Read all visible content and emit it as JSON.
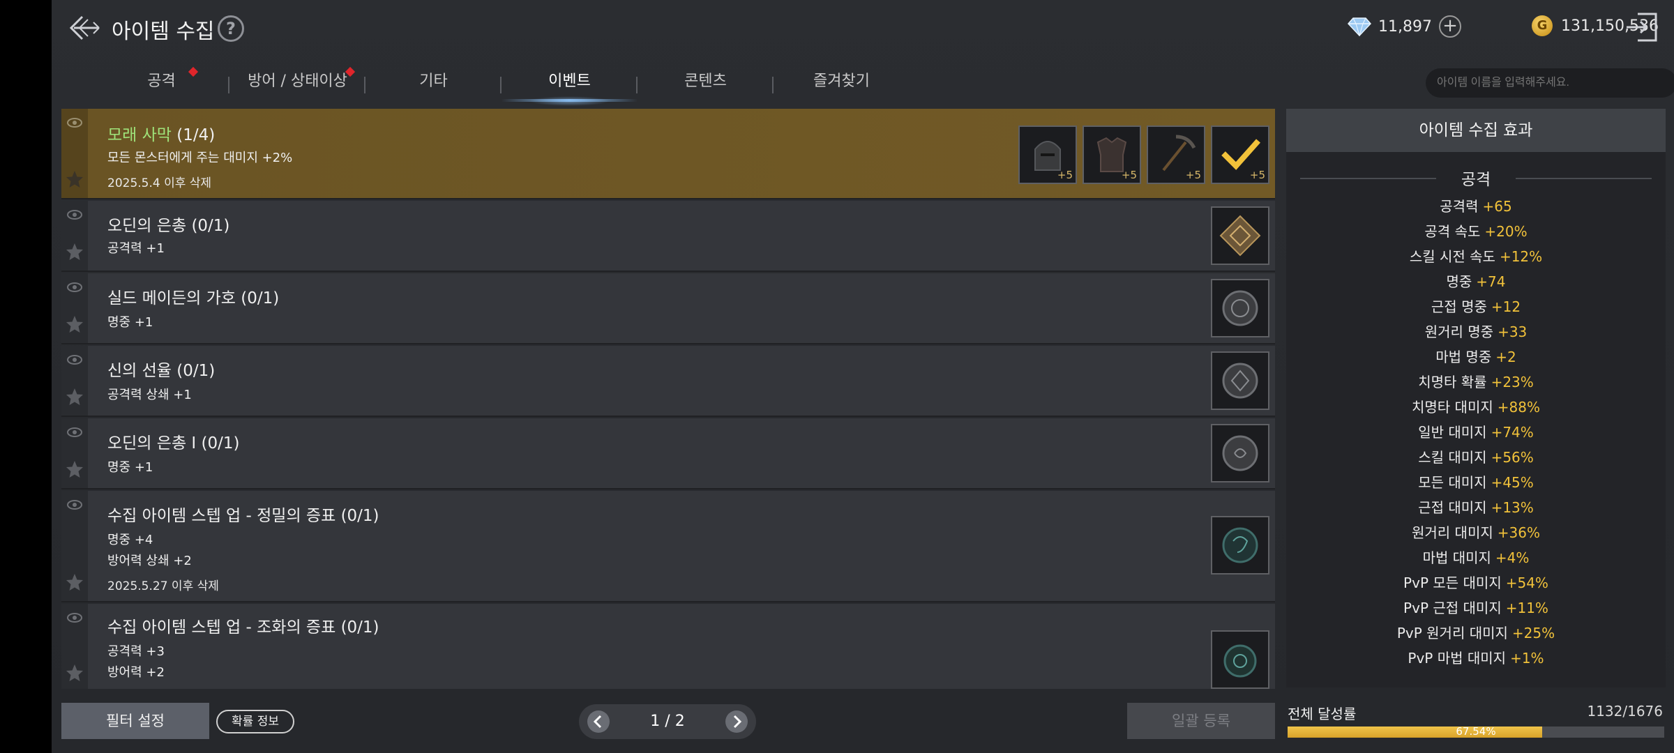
{
  "header": {
    "title": "아이템 수집",
    "help_icon": "?",
    "diamond": "11,897",
    "plus": "+",
    "gold_icon": "G",
    "gold": "131,150,536"
  },
  "tabs": [
    {
      "label": "공격",
      "new": true
    },
    {
      "label": "방어 / 상태이상",
      "new": true
    },
    {
      "label": "기타",
      "new": false
    },
    {
      "label": "이벤트",
      "new": false,
      "active": true
    },
    {
      "label": "콘텐츠",
      "new": false
    },
    {
      "label": "즐겨찾기",
      "new": false
    }
  ],
  "search": {
    "placeholder": "아이템 이름을 입력해주세요."
  },
  "collections": [
    {
      "name": "모래 사막",
      "progress": "(1/4)",
      "lines": [
        "모든 몬스터에게 주는 대미지 +2%"
      ],
      "note": "2025.5.4 이후 삭제",
      "slot_levels": [
        "+5",
        "+5",
        "+5",
        "+5"
      ]
    },
    {
      "name": "오딘의 은총",
      "progress": "(0/1)",
      "lines": [
        "공격력 +1"
      ]
    },
    {
      "name": "실드 메이든의 가호",
      "progress": "(0/1)",
      "lines": [
        "명중 +1"
      ]
    },
    {
      "name": "신의 선율",
      "progress": "(0/1)",
      "lines": [
        "공격력 상쇄 +1"
      ]
    },
    {
      "name": "오딘의 은총 I",
      "progress": "(0/1)",
      "lines": [
        "명중 +1"
      ]
    },
    {
      "name": "수집 아이템 스텝 업 - 정밀의 증표",
      "progress": "(0/1)",
      "lines": [
        "명중 +4",
        "방어력 상쇄 +2"
      ],
      "note": "2025.5.27 이후 삭제"
    },
    {
      "name": "수집 아이템 스텝 업 - 조화의 증표",
      "progress": "(0/1)",
      "lines": [
        "공격력 +3",
        "방어력 +2"
      ]
    }
  ],
  "footer": {
    "filter": "필터 설정",
    "prob_info": "확률 정보",
    "page": "1 / 2",
    "batch": "일괄 등록"
  },
  "panel": {
    "title": "아이템 수집 효과",
    "section": "공격",
    "stats": [
      {
        "label": "공격력",
        "value": "+65"
      },
      {
        "label": "공격 속도",
        "value": "+20%"
      },
      {
        "label": "스킬 시전 속도",
        "value": "+12%"
      },
      {
        "label": "명중",
        "value": "+74"
      },
      {
        "label": "근접 명중",
        "value": "+12"
      },
      {
        "label": "원거리 명중",
        "value": "+33"
      },
      {
        "label": "마법 명중",
        "value": "+2"
      },
      {
        "label": "치명타 확률",
        "value": "+23%"
      },
      {
        "label": "치명타 대미지",
        "value": "+88%"
      },
      {
        "label": "일반 대미지",
        "value": "+74%"
      },
      {
        "label": "스킬 대미지",
        "value": "+56%"
      },
      {
        "label": "모든 대미지",
        "value": "+45%"
      },
      {
        "label": "근접 대미지",
        "value": "+13%"
      },
      {
        "label": "원거리 대미지",
        "value": "+36%"
      },
      {
        "label": "마법 대미지",
        "value": "+4%"
      },
      {
        "label": "PvP 모든 대미지",
        "value": "+54%"
      },
      {
        "label": "PvP 근접 대미지",
        "value": "+11%"
      },
      {
        "label": "PvP 원거리 대미지",
        "value": "+25%"
      },
      {
        "label": "PvP 마법 대미지",
        "value": "+1%"
      }
    ]
  },
  "progress": {
    "label": "전체 달성률",
    "count": "1132/1676",
    "percent_text": "67.54%",
    "fraction": 0.6754
  },
  "colors": {
    "accent_gold": "#f2c23a",
    "highlight_row": "#6a5424",
    "collection_green": "#9fe37a"
  }
}
